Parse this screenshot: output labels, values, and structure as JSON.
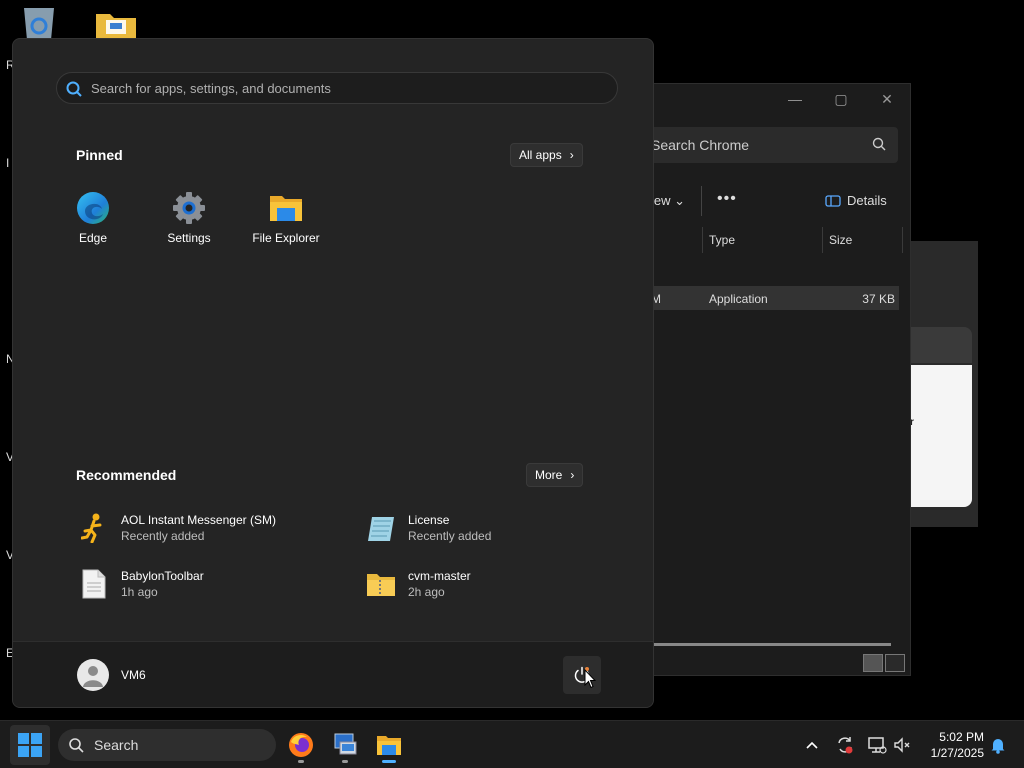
{
  "desktop": {
    "icons": [
      {
        "name": "recycle-bin-icon"
      },
      {
        "name": "folder-icon"
      }
    ],
    "edge_letters": [
      "R",
      "I",
      "N",
      "V",
      "V",
      "E"
    ]
  },
  "explorer": {
    "window_controls": [
      "—",
      "▢",
      "✕"
    ],
    "search_placeholder": "Search Chrome",
    "toolbar": {
      "view": "iew",
      "more": "•••",
      "details": "Details"
    },
    "columns": [
      "Type",
      "Size"
    ],
    "row": {
      "name_fragment": "M",
      "type": "Application",
      "size": "37 KB"
    }
  },
  "dialog": {
    "fragment": "r"
  },
  "start_menu": {
    "search_placeholder": "Search for apps, settings, and documents",
    "pinned": {
      "title": "Pinned",
      "all_apps": "All apps",
      "apps": [
        {
          "label": "Edge",
          "icon": "edge-icon"
        },
        {
          "label": "Settings",
          "icon": "settings-gear-icon"
        },
        {
          "label": "File Explorer",
          "icon": "folder-icon"
        }
      ]
    },
    "recommended": {
      "title": "Recommended",
      "more": "More",
      "items": [
        {
          "name": "AOL Instant Messenger (SM)",
          "sub": "Recently added",
          "icon": "aim-runner-icon"
        },
        {
          "name": "License",
          "sub": "Recently added",
          "icon": "notepad-icon"
        },
        {
          "name": "BabylonToolbar",
          "sub": "1h ago",
          "icon": "document-icon"
        },
        {
          "name": "cvm-master",
          "sub": "2h ago",
          "icon": "zip-folder-icon"
        }
      ]
    },
    "user": {
      "name": "VM6"
    },
    "power_icon": "power-icon"
  },
  "taskbar": {
    "search_label": "Search",
    "apps": [
      "firefox-icon",
      "remote-desktop-icon",
      "file-explorer-icon"
    ],
    "clock": {
      "time": "5:02 PM",
      "date": "1/27/2025"
    }
  },
  "colors": {
    "accent": "#3b9bff",
    "folder": "#f8c33a"
  }
}
